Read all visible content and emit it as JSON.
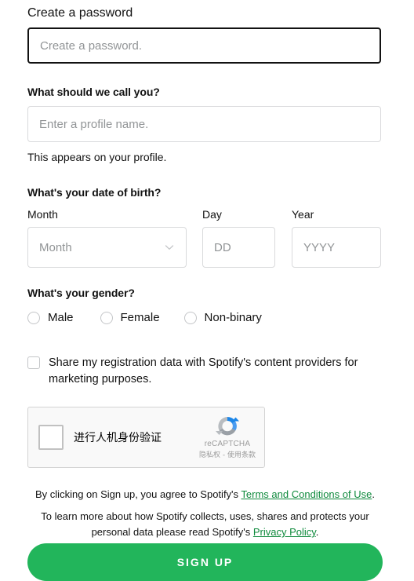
{
  "password_section": {
    "label": "Create a password",
    "placeholder": "Create a password."
  },
  "profile_section": {
    "label": "What should we call you?",
    "placeholder": "Enter a profile name.",
    "helper": "This appears on your profile."
  },
  "dob_section": {
    "label": "What's your date of birth?",
    "month": {
      "sublabel": "Month",
      "value": "Month",
      "icon": "chevron-down-icon"
    },
    "day": {
      "sublabel": "Day",
      "placeholder": "DD"
    },
    "year": {
      "sublabel": "Year",
      "placeholder": "YYYY"
    }
  },
  "gender_section": {
    "label": "What's your gender?",
    "options": [
      {
        "label": "Male",
        "selected": false
      },
      {
        "label": "Female",
        "selected": false
      },
      {
        "label": "Non-binary",
        "selected": false
      }
    ]
  },
  "marketing": {
    "text": "Share my registration data with Spotify's content providers for marketing purposes.",
    "checked": false
  },
  "recaptcha": {
    "checkbox_label": "进行人机身份验证",
    "brand": "reCAPTCHA",
    "links": "隐私权 - 使用条款",
    "logo_icon": "recaptcha-logo-icon",
    "checked": false
  },
  "legal": {
    "line1_prefix": "By clicking on Sign up, you agree to Spotify's ",
    "line1_link": "Terms and Conditions of Use",
    "line1_suffix": ".",
    "line2_prefix": "To learn more about how Spotify collects, uses, shares and protects your personal data please read Spotify's ",
    "line2_link": "Privacy Policy",
    "line2_suffix": "."
  },
  "signup_button": {
    "label": "SIGN UP"
  },
  "colors": {
    "accent_green": "#22b55b",
    "link_green": "#0f8a3d",
    "text": "#121212",
    "placeholder": "#919496",
    "border_light": "#d9dadc",
    "border_focus": "#121212"
  }
}
